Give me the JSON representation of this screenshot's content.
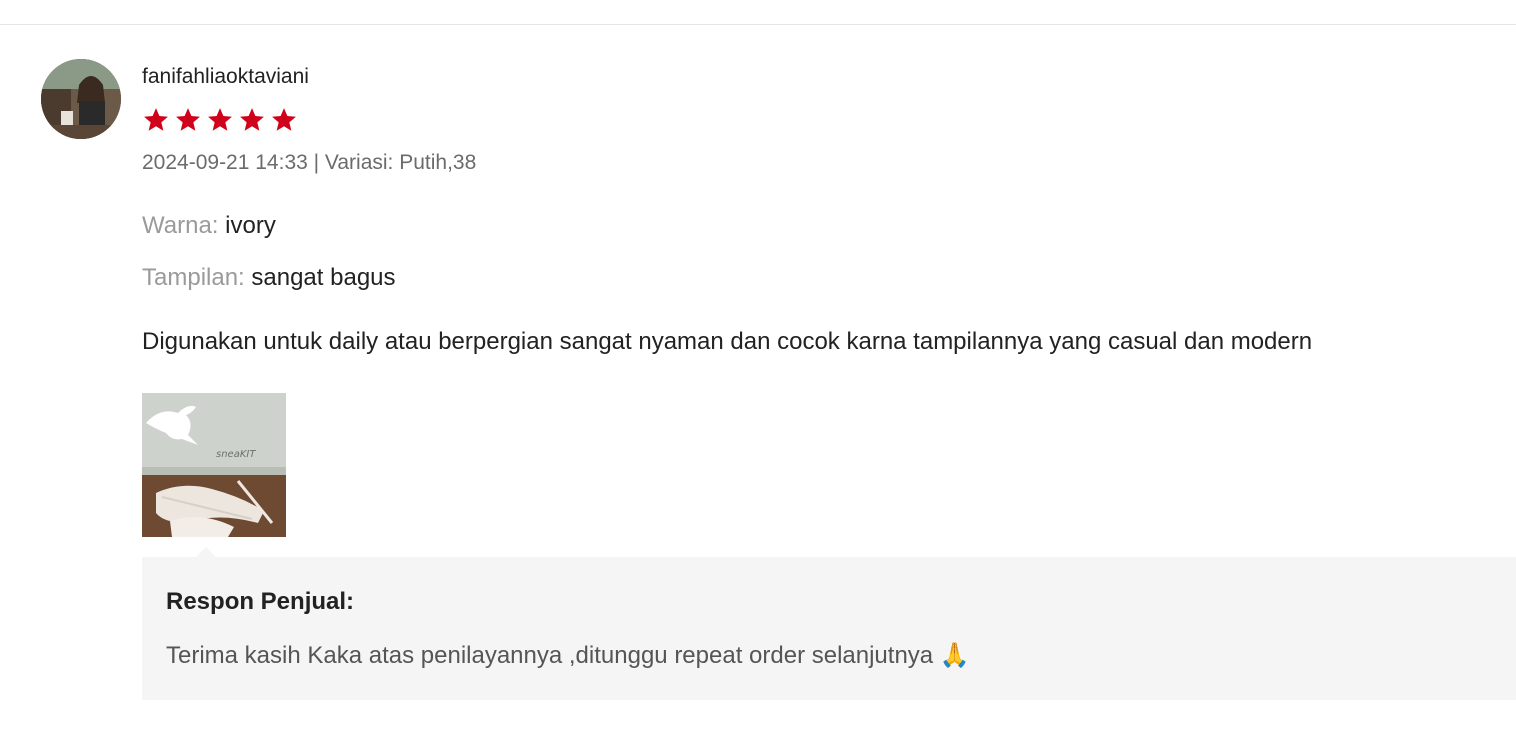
{
  "review": {
    "username": "fanifahliaoktaviani",
    "rating": 5,
    "rating_max": 5,
    "star_color": "#d0011b",
    "meta": "2024-09-21 14:33 | Variasi: Putih,38",
    "attributes": [
      {
        "label": "Warna:",
        "value": "ivory"
      },
      {
        "label": "Tampilan:",
        "value": "sangat bagus"
      }
    ],
    "text": "Digunakan untuk daily atau berpergian sangat nyaman dan cocok karna tampilannya yang casual dan modern",
    "photo": {
      "box_brand": "sneaKIT",
      "icons": [
        "kangaroo-logo"
      ]
    }
  },
  "seller_response": {
    "title": "Respon Penjual:",
    "text": "Terima kasih Kaka atas penilayannya ,ditunggu repeat order selanjutnya 🙏"
  }
}
